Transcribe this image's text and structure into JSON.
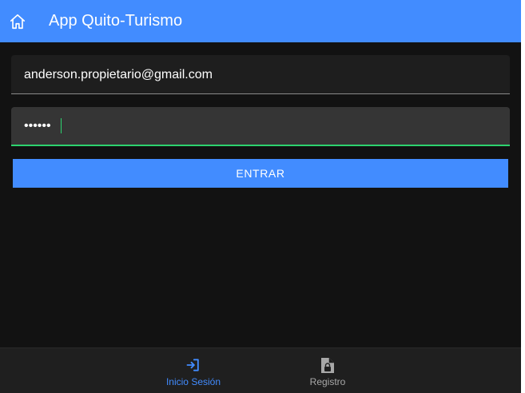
{
  "header": {
    "title": "App Quito-Turismo",
    "icon": "home-icon"
  },
  "form": {
    "email_value": "anderson.propietario@gmail.com",
    "password_value": "••••••",
    "submit_label": "ENTRAR"
  },
  "tabs": [
    {
      "label": "Inicio Sesión",
      "icon": "login-icon",
      "active": true
    },
    {
      "label": "Registro",
      "icon": "document-lock-icon",
      "active": false
    }
  ],
  "colors": {
    "primary": "#428cff",
    "background": "#121212",
    "focus_underline": "#2dd36f",
    "inactive_tab": "#a8a8a8"
  }
}
